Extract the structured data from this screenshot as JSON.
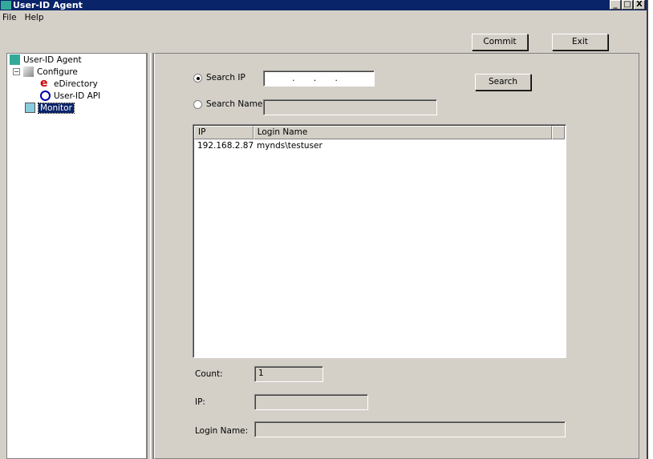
{
  "window": {
    "title": "User-ID Agent",
    "controls": [
      "_",
      "□",
      "X"
    ]
  },
  "menu": [
    "File",
    "Help"
  ],
  "toolbar": {
    "commit": "Commit",
    "exit": "Exit"
  },
  "tree": {
    "root": "User-ID Agent",
    "configure": "Configure",
    "edirectory": "eDirectory",
    "userid_api": "User-ID API",
    "monitor": "Monitor",
    "selected": "Monitor"
  },
  "search": {
    "ip_label": "Search IP",
    "ip_value": ".  .  .",
    "name_label": "Search Name",
    "name_value": "",
    "selected": "Search IP",
    "button": "Search"
  },
  "table": {
    "columns": [
      "IP",
      "Login Name"
    ],
    "rows": [
      [
        "192.168.2.87",
        "mynds\\testuser"
      ]
    ]
  },
  "details": {
    "count_label": "Count:",
    "count_value": "1",
    "ip_label": "IP:",
    "ip_value": "",
    "login_label": "Login Name:",
    "login_value": ""
  }
}
